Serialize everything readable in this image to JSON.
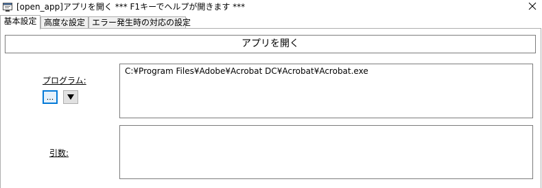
{
  "window": {
    "title": "[open_app]アプリを開く *** F1キーでヘルプが開きます ***",
    "app_icon": "dialog-window-icon",
    "close_icon": "close-icon"
  },
  "tabs": [
    {
      "label": "基本設定",
      "active": true
    },
    {
      "label": "高度な設定",
      "active": false
    },
    {
      "label": "エラー発生時の対応の設定",
      "active": false
    }
  ],
  "header": {
    "label": "アプリを開く"
  },
  "program": {
    "label": "プログラム:",
    "value": "C:¥Program Files¥Adobe¥Acrobat DC¥Acrobat¥Acrobat.exe",
    "browse_label": "...",
    "dropdown_icon": "triangle-down-icon"
  },
  "arguments": {
    "label": "引数:",
    "value": ""
  },
  "colors": {
    "focus_border": "#0078d7",
    "border": "#7a7a7a",
    "tab_border": "#adadad"
  }
}
